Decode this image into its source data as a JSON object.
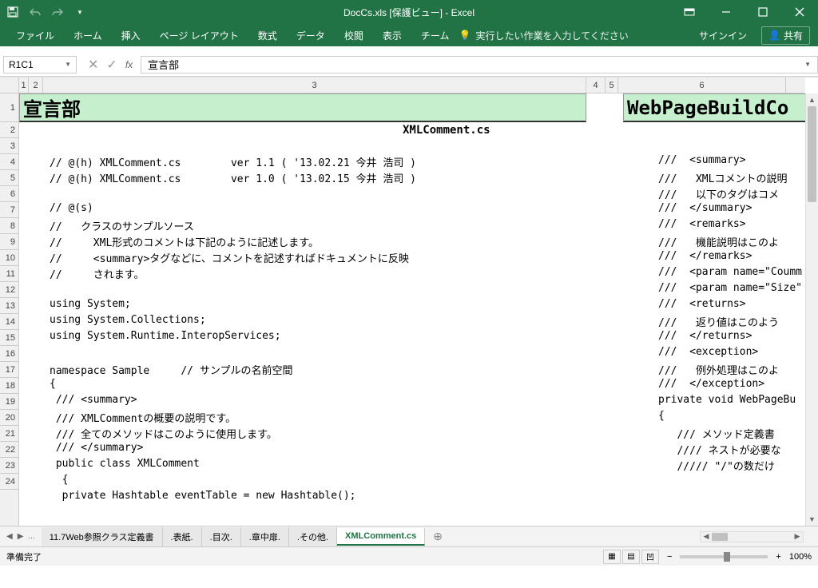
{
  "title": "DocCs.xls  [保護ビュー] - Excel",
  "qat": {
    "save": "保存",
    "undo": "元に戻す",
    "redo": "やり直し"
  },
  "ribbon": {
    "file": "ファイル",
    "home": "ホーム",
    "insert": "挿入",
    "pagelayout": "ページ レイアウト",
    "formulas": "数式",
    "data": "データ",
    "review": "校閲",
    "view": "表示",
    "team": "チーム",
    "tellme": "実行したい作業を入力してください",
    "signin": "サインイン",
    "share": "共有"
  },
  "namebox": "R1C1",
  "formula": "宣言部",
  "cols": {
    "c1": "1",
    "c2": "2",
    "c3": "3",
    "c4": "4",
    "c5": "5",
    "c6": "6"
  },
  "rows": {
    "r1": "1",
    "r2": "2",
    "r3": "3",
    "r4": "4",
    "r5": "5",
    "r6": "6",
    "r7": "7",
    "r8": "8",
    "r9": "9",
    "r10": "10",
    "r11": "11",
    "r12": "12",
    "r13": "13",
    "r14": "14",
    "r15": "15",
    "r16": "16",
    "r17": "17",
    "r18": "18",
    "r19": "19",
    "r20": "20",
    "r21": "21",
    "r22": "22",
    "r23": "23",
    "r24": "24"
  },
  "title1": "宣言部",
  "title2": "WebPageBuildCo",
  "filename_label": "XMLComment.cs",
  "code": {
    "l3": "// @(h) XMLComment.cs        ver 1.1 ( '13.02.21 今井 浩司 )",
    "l4": "// @(h) XMLComment.cs        ver 1.0 ( '13.02.15 今井 浩司 )",
    "l6": "// @(s)",
    "l7": "//   クラスのサンプルソース",
    "l8": "//     XML形式のコメントは下記のように記述します。",
    "l9": "//     <summary>タグなどに、コメントを記述すればドキュメントに反映",
    "l10": "//     されます。",
    "l12": "using System;",
    "l13": "using System.Collections;",
    "l14": "using System.Runtime.InteropServices;",
    "l16": "namespace Sample     // サンプルの名前空間",
    "l17": "{",
    "l18": " /// <summary>",
    "l19": " /// XMLCommentの概要の説明です。",
    "l20": " /// 全てのメソッドはこのように使用します。",
    "l21": " /// </summary>",
    "l22": " public class XMLComment",
    "l23": "  {",
    "l24": "  private Hashtable eventTable = new Hashtable();"
  },
  "code_r": {
    "l3": "///  <summary>",
    "l4": "///   XMLコメントの説明",
    "l5": "///   以下のタグはコメ",
    "l6": "///  </summary>",
    "l7": "///  <remarks>",
    "l8": "///   機能説明はこのよ",
    "l9": "///  </remarks>",
    "l10": "///  <param name=\"Coumm",
    "l11": "///  <param name=\"Size\"",
    "l12": "///  <returns>",
    "l13": "///   返り値はこのよう",
    "l14": "///  </returns>",
    "l15": "///  <exception>",
    "l16": "///   例外処理はこのよ",
    "l17": "///  </exception>",
    "l18": "private void WebPageBu",
    "l19": "{",
    "l20": "   /// メソッド定義書",
    "l21": "   //// ネストが必要な",
    "l22": "   ///// \"/\"の数だけ"
  },
  "tabs": {
    "ellipsis": "...",
    "t1": "11.7Web参照クラス定義書",
    "t2": ".表紙.",
    "t3": ".目次.",
    "t4": ".章中扉.",
    "t5": ".その他.",
    "t6": "XMLComment.cs"
  },
  "status": {
    "ready": "準備完了",
    "zoom": "100%"
  }
}
